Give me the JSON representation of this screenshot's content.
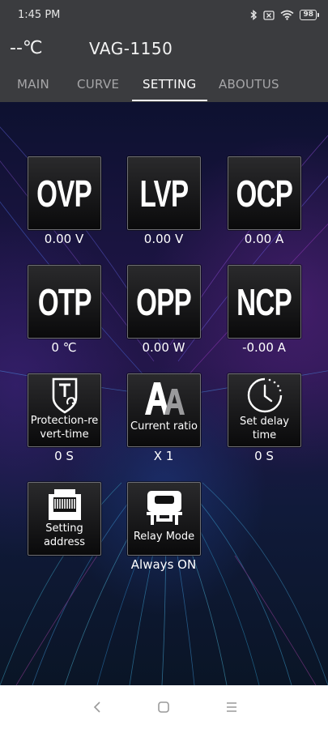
{
  "status_bar": {
    "time": "1:45 PM",
    "battery": "98",
    "icons": [
      "bluetooth-icon",
      "sim-none-icon",
      "wifi-icon",
      "battery-icon"
    ]
  },
  "header": {
    "temperature": "--℃",
    "model": "VAG-1150"
  },
  "tabs": [
    {
      "label": "MAIN",
      "active": false
    },
    {
      "label": "CURVE",
      "active": false
    },
    {
      "label": "SETTING",
      "active": true
    },
    {
      "label": "ABOUTUS",
      "active": false
    }
  ],
  "settings": [
    {
      "label": "OVP",
      "value": "0.00 V"
    },
    {
      "label": "LVP",
      "value": "0.00 V"
    },
    {
      "label": "OCP",
      "value": "0.00 A"
    },
    {
      "label": "OTP",
      "value": "0 ℃"
    },
    {
      "label": "OPP",
      "value": "0.00 W"
    },
    {
      "label": "NCP",
      "value": "-0.00 A"
    },
    {
      "label_lines": [
        "Protection-re",
        "vert-time"
      ],
      "value": "0 S",
      "icon": "protection-revert-icon"
    },
    {
      "label": "Current ratio",
      "value": "X 1",
      "icon": "font-aa-icon"
    },
    {
      "label_lines": [
        "Set delay",
        "time"
      ],
      "value": "0 S",
      "icon": "clock-icon"
    },
    {
      "label_lines": [
        "Setting",
        "address"
      ],
      "icon": "ethernet-port-icon"
    },
    {
      "label": "Relay Mode",
      "value": "Always ON",
      "icon": "relay-connector-icon"
    }
  ],
  "nav_bar": {
    "icons": [
      "back-icon",
      "home-icon",
      "menu-icon"
    ]
  },
  "colors": {
    "bar_bg": "#3b3c3f",
    "button_border": "#6e6e72",
    "tab_active": "#ffffff",
    "tab_inactive": "#a6a6a8"
  }
}
